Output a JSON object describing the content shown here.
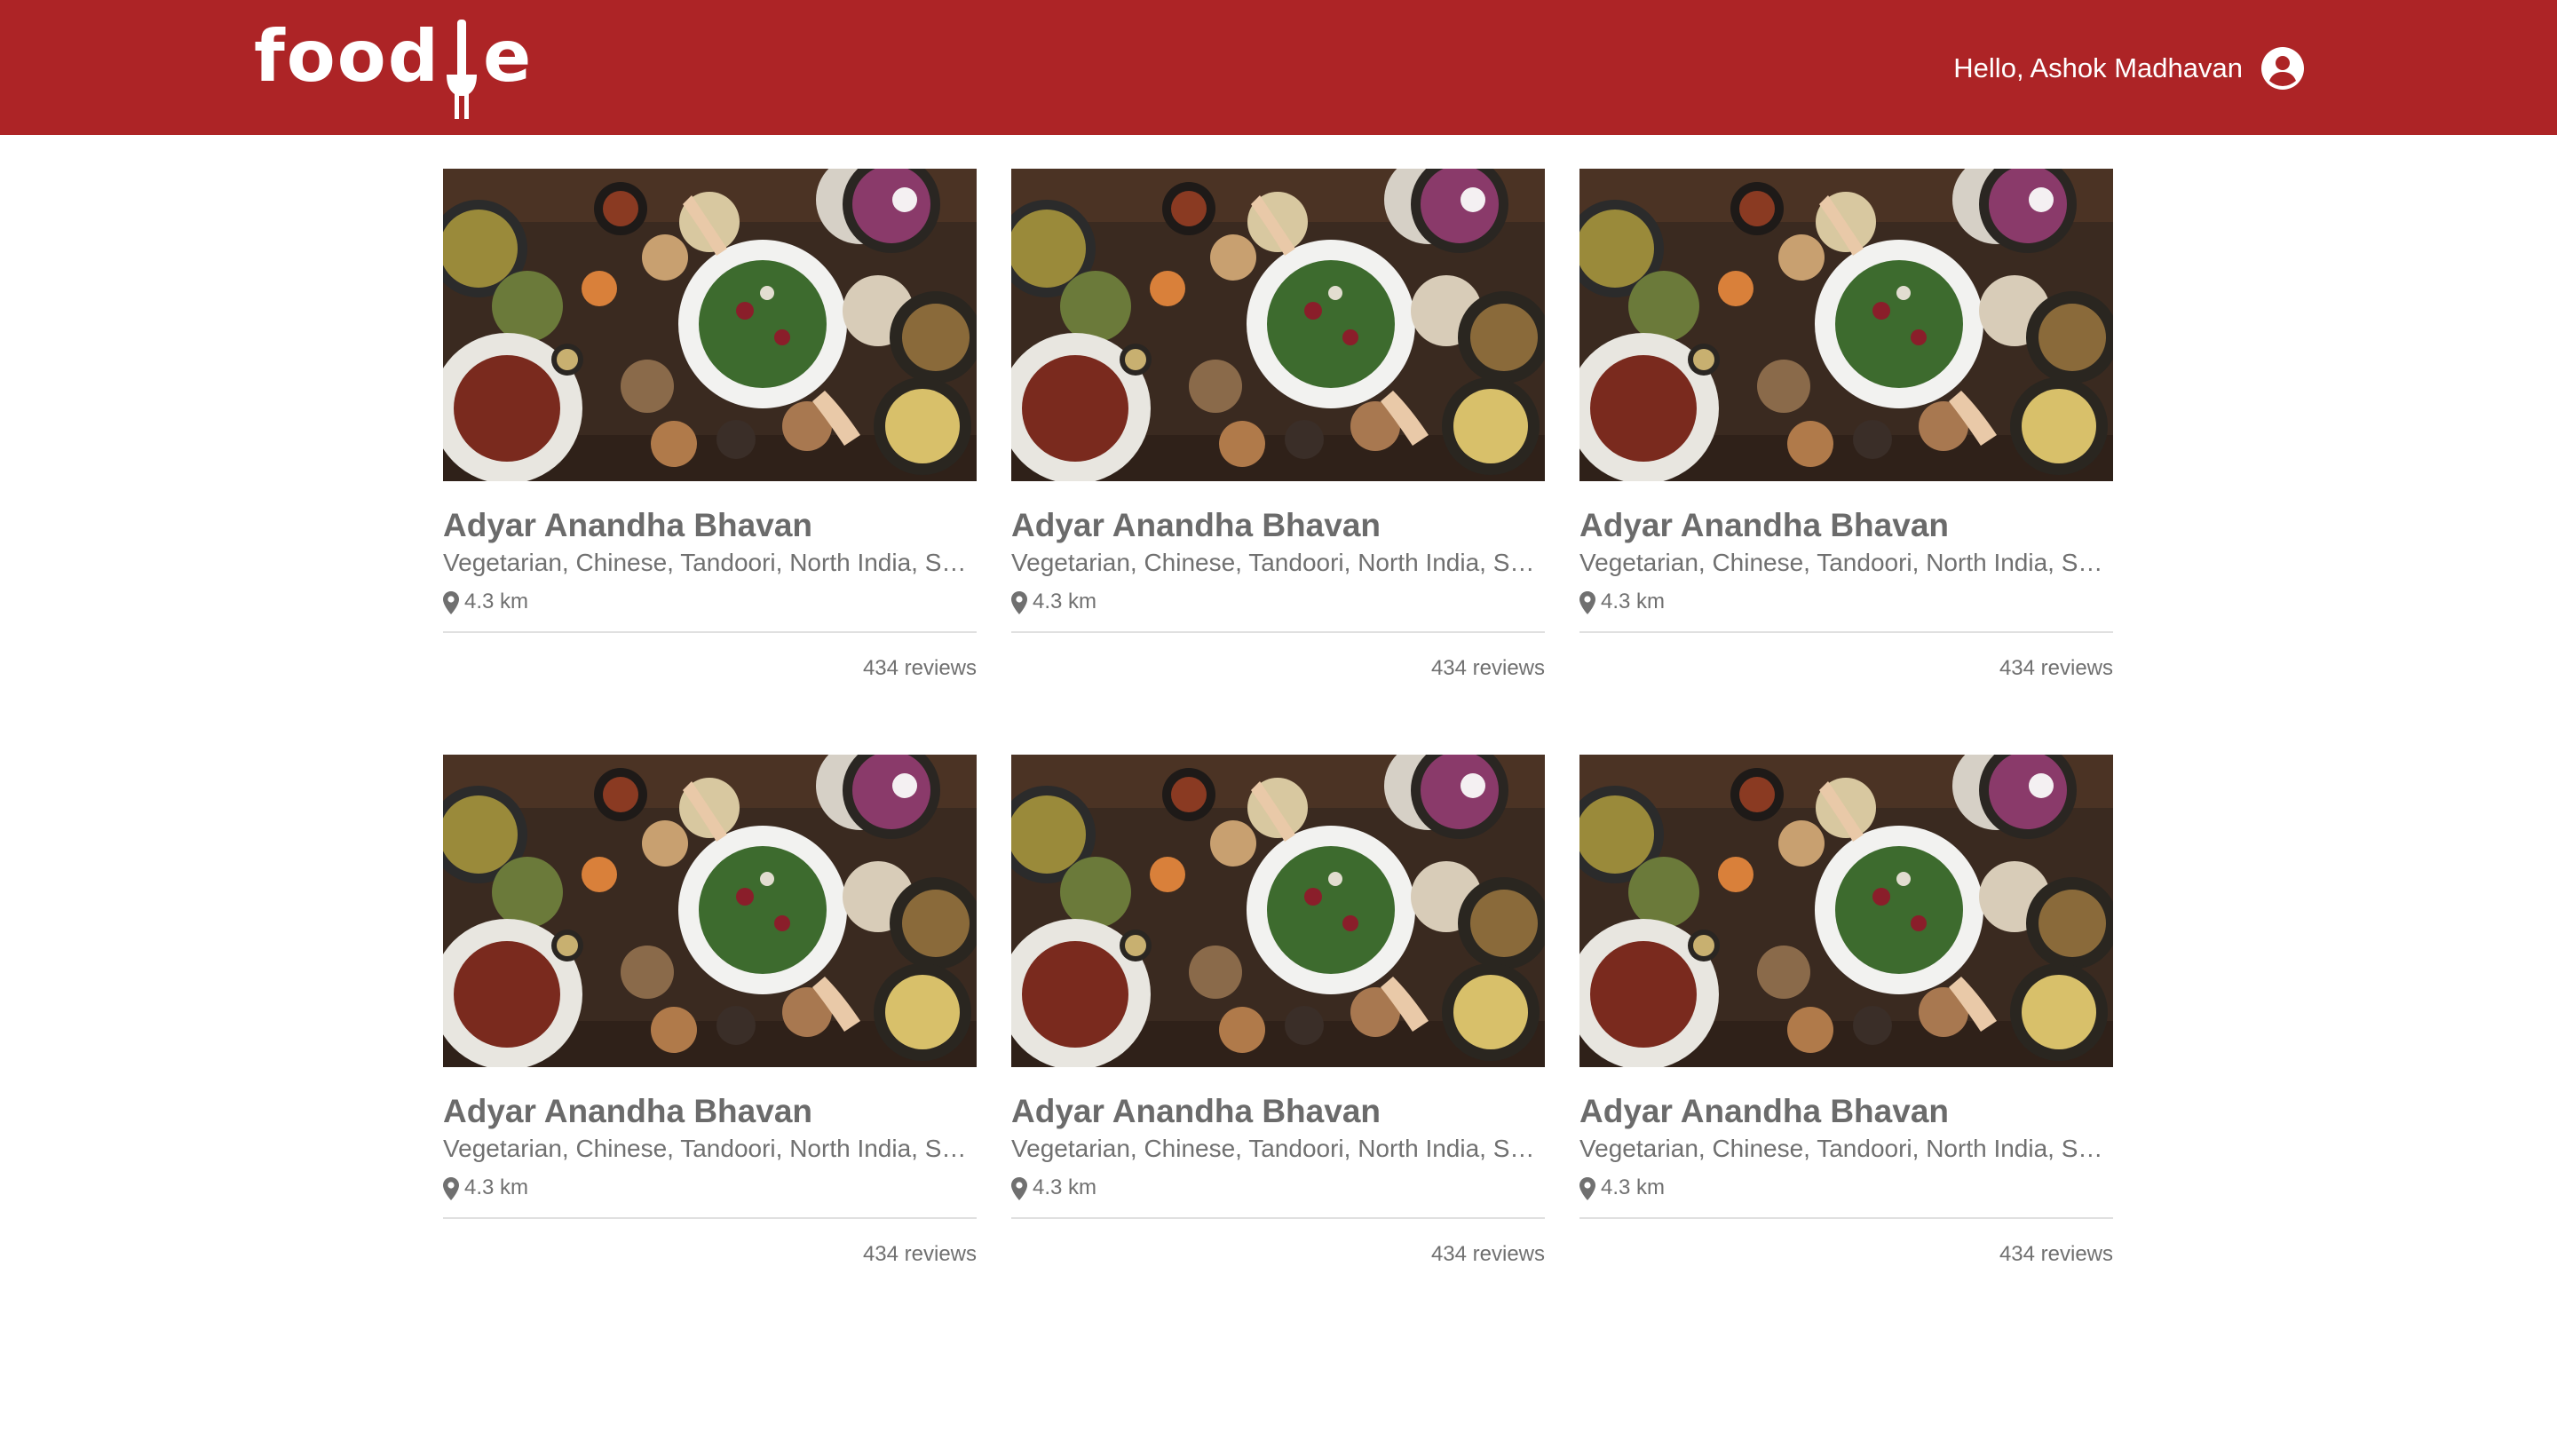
{
  "header": {
    "logo_left": "food",
    "logo_right": "e",
    "greeting": "Hello, Ashok Madhavan",
    "user_icon": "user-circle-icon",
    "background_color": "#ad2426"
  },
  "restaurants": [
    {
      "name": "Adyar Anandha Bhavan",
      "cuisines": "Vegetarian, Chinese, Tandoori, North India, South Indian",
      "distance": "4.3 km",
      "reviews": "434 reviews",
      "image": "food-platter-photo"
    },
    {
      "name": "Adyar Anandha Bhavan",
      "cuisines": "Vegetarian, Chinese, Tandoori, North India, South Indian",
      "distance": "4.3 km",
      "reviews": "434 reviews",
      "image": "food-platter-photo"
    },
    {
      "name": "Adyar Anandha Bhavan",
      "cuisines": "Vegetarian, Chinese, Tandoori, North India, South Indian",
      "distance": "4.3 km",
      "reviews": "434 reviews",
      "image": "food-platter-photo"
    },
    {
      "name": "Adyar Anandha Bhavan",
      "cuisines": "Vegetarian, Chinese, Tandoori, North India, South Indian",
      "distance": "4.3 km",
      "reviews": "434 reviews",
      "image": "food-platter-photo"
    },
    {
      "name": "Adyar Anandha Bhavan",
      "cuisines": "Vegetarian, Chinese, Tandoori, North India, South Indian",
      "distance": "4.3 km",
      "reviews": "434 reviews",
      "image": "food-platter-photo"
    },
    {
      "name": "Adyar Anandha Bhavan",
      "cuisines": "Vegetarian, Chinese, Tandoori, North India, South Indian",
      "distance": "4.3 km",
      "reviews": "434 reviews",
      "image": "food-platter-photo"
    }
  ]
}
